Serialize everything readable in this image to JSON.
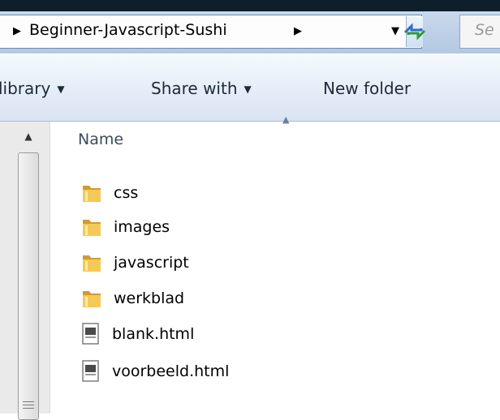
{
  "address": {
    "breadcrumb": "Beginner-Javascript-Sushi",
    "search_placeholder": "Se"
  },
  "toolbar": {
    "library_label": "library",
    "share_label": "Share with",
    "new_folder_label": "New folder"
  },
  "filelist": {
    "name_header": "Name",
    "items": [
      {
        "name": "css",
        "type": "folder"
      },
      {
        "name": "images",
        "type": "folder"
      },
      {
        "name": "javascript",
        "type": "folder"
      },
      {
        "name": "werkblad",
        "type": "folder"
      },
      {
        "name": "blank.html",
        "type": "html-file"
      },
      {
        "name": "voorbeeld.html",
        "type": "html-file"
      }
    ]
  },
  "colors": {
    "toolbar_text": "#1e2b3a",
    "folder": "#e8b64a",
    "accent": "#3a78c8"
  }
}
